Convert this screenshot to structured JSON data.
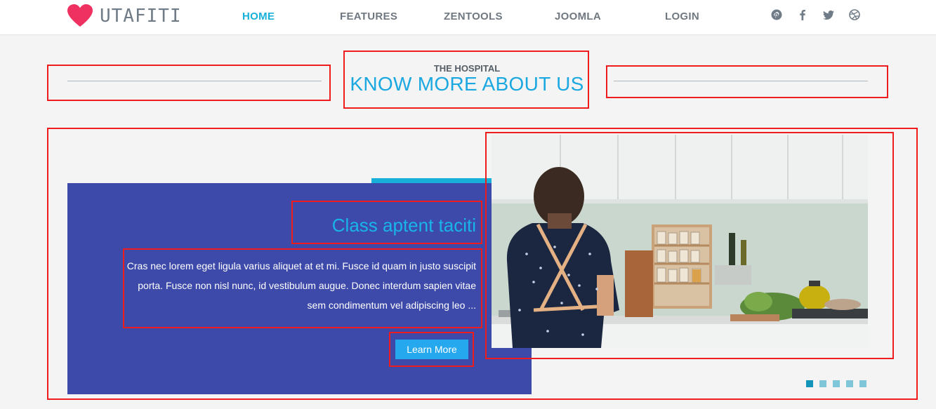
{
  "header": {
    "brand": "UTAFITI",
    "nav": [
      {
        "label": "HOME",
        "active": true
      },
      {
        "label": "FEATURES",
        "active": false
      },
      {
        "label": "ZENTOOLS",
        "active": false
      },
      {
        "label": "JOOMLA",
        "active": false
      },
      {
        "label": "LOGIN",
        "active": false
      }
    ],
    "social_icons": [
      "pinterest-icon",
      "facebook-icon",
      "twitter-icon",
      "dribbble-icon"
    ]
  },
  "section": {
    "subtitle": "THE HOSPITAL",
    "title": "KNOW MORE ABOUT US"
  },
  "slide": {
    "heading": "Class aptent taciti",
    "text": "Cras nec lorem eget ligula varius aliquet at et mi. Fusce id quam in justo suscipit porta. Fusce non nisl nunc, id vestibulum augue. Donec interdum sapien vitae sem condimentum vel adipiscing leo ...",
    "button": "Learn More"
  },
  "slider": {
    "slide_count": 5,
    "active_index": 0
  },
  "colors": {
    "accent": "#17b0d9",
    "panel": "#3d4aaa",
    "heart": "#ef3161",
    "button": "#26a8ef",
    "highlight_box": "#ee1c1c"
  }
}
